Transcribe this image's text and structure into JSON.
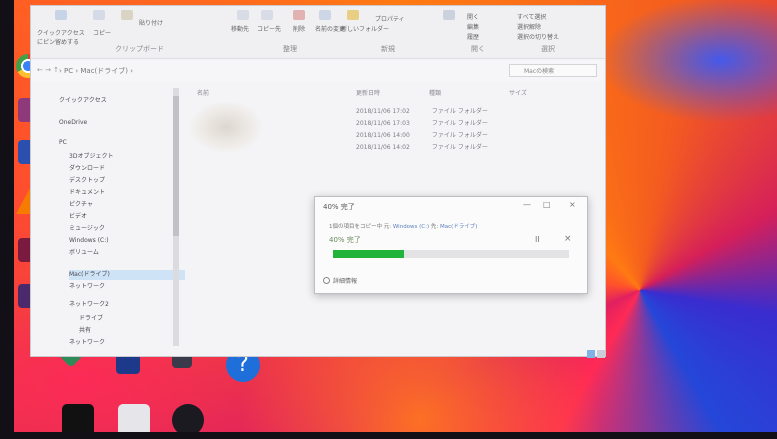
{
  "explorer": {
    "ribbon": {
      "groups": [
        "クリップボード",
        "整理",
        "新規",
        "開く",
        "選択"
      ],
      "buttons": [
        "クイックアクセスにピン留めする",
        "コピー",
        "貼り付け",
        "移動先",
        "コピー先",
        "削除",
        "名前の変更",
        "新しいフォルダー",
        "プロパティ",
        "開く",
        "編集",
        "履歴",
        "すべて選択",
        "選択解除",
        "選択の切り替え"
      ]
    },
    "address": {
      "path": "› PC › Mac(ドライブ) ›",
      "search_placeholder": "Macの検索"
    },
    "nav": {
      "items": [
        "クイックアクセス",
        "OneDrive",
        "PC",
        "3Dオブジェクト",
        "ダウンロード",
        "デスクトップ",
        "ドキュメント",
        "ピクチャ",
        "ビデオ",
        "ミュージック",
        "Windows (C:)",
        "ボリューム",
        "Mac(ドライブ)",
        "ネットワーク",
        "ネットワーク2",
        "ドライブ",
        "共有",
        "ネットワーク"
      ]
    },
    "columns": {
      "name": "名前",
      "date": "更新日時",
      "type": "種類",
      "size": "サイズ"
    },
    "files": [
      {
        "date": "2018/11/06 17:02",
        "type": "ファイル フォルダー"
      },
      {
        "date": "2018/11/06 17:03",
        "type": "ファイル フォルダー"
      },
      {
        "date": "2018/11/06 14:00",
        "type": "ファイル フォルダー"
      },
      {
        "date": "2018/11/06 14:02",
        "type": "ファイル フォルダー"
      }
    ]
  },
  "dialog": {
    "title": "40% 完了",
    "description_prefix": "1個の項目をコピー中 元: ",
    "description_source": "Windows (C:)",
    "description_mid": " 先: ",
    "description_dest": "Mac(ドライブ)",
    "status": "40% 完了",
    "progress": 0.3,
    "more_details": "詳細情報",
    "minimize": "—",
    "maximize": "□",
    "close": "×",
    "pause": "II",
    "cancel": "×"
  },
  "colors": {
    "progress": "#21b43a",
    "selection": "#cfe3f7"
  }
}
